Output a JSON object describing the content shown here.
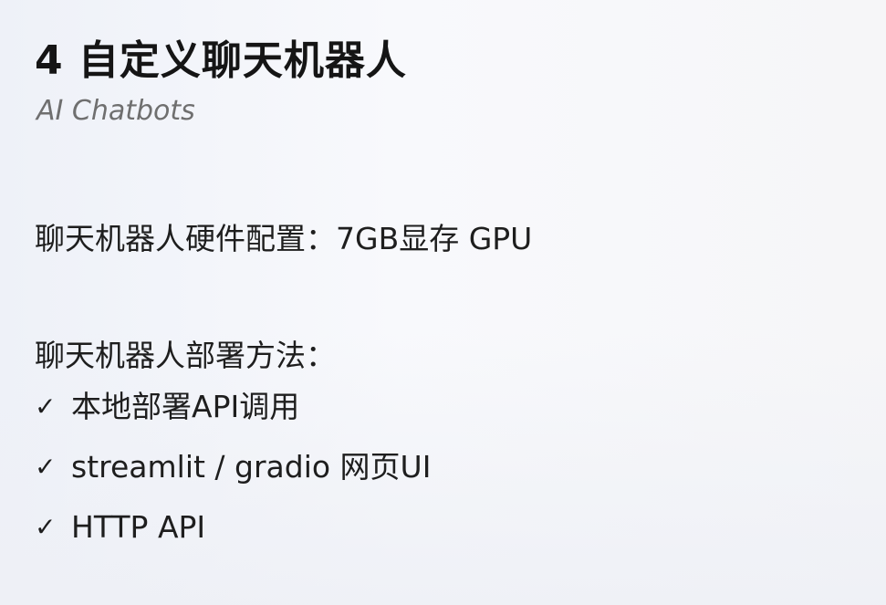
{
  "slide": {
    "title": "4 自定义聊天机器人",
    "subtitle": "AI Chatbots",
    "hardware_line": "聊天机器人硬件配置：7GB显存 GPU",
    "deploy_heading": "聊天机器人部署方法：",
    "deploy_methods": [
      {
        "icon": "check-icon",
        "label": "本地部署API调用"
      },
      {
        "icon": "check-icon",
        "label": "streamlit / gradio 网页UI"
      },
      {
        "icon": "check-icon",
        "label": "HTTP API"
      }
    ],
    "check_glyph": "✓"
  }
}
